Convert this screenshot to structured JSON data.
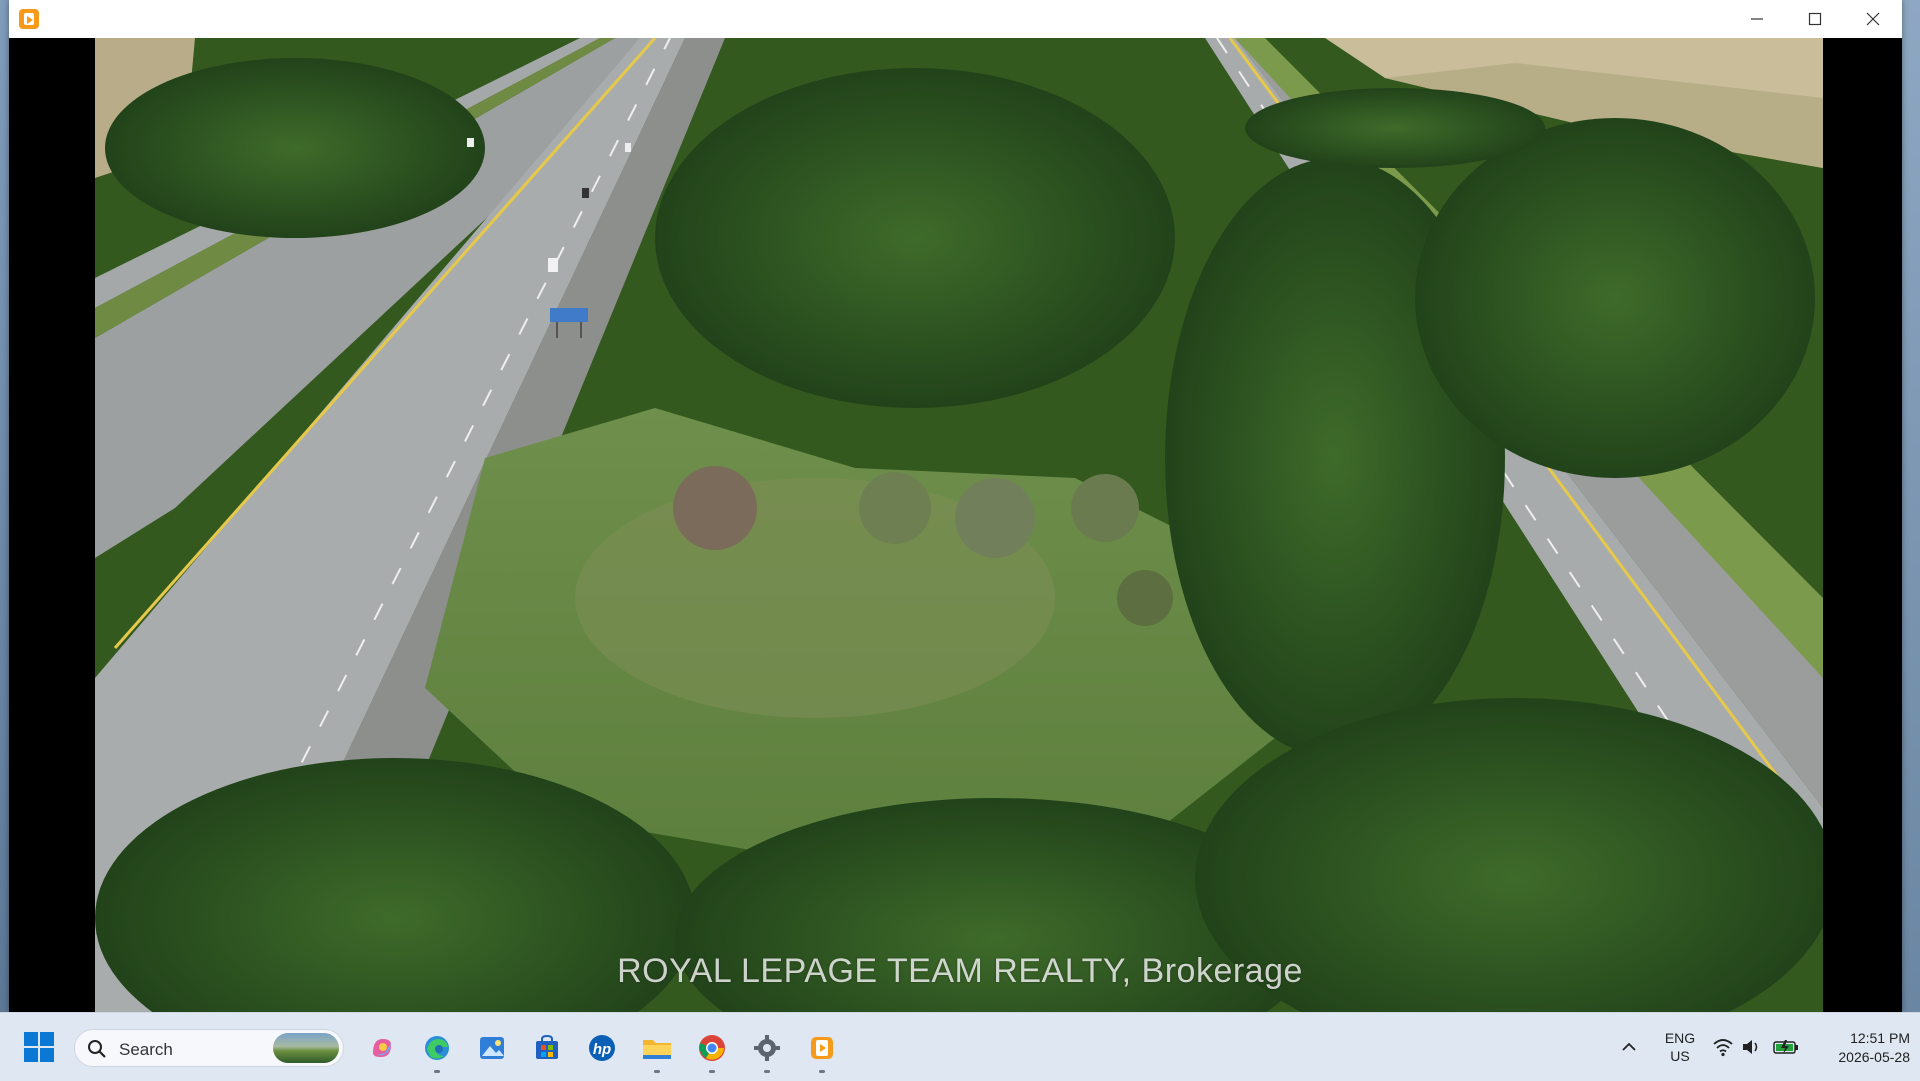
{
  "window": {
    "app_icon": "media-player-icon",
    "controls": [
      "minimize-icon",
      "maximize-icon",
      "close-icon"
    ]
  },
  "photo": {
    "description_icon": "aerial-photo",
    "watermark": "ROYAL LEPAGE TEAM REALTY, Brokerage"
  },
  "taskbar": {
    "start_icon": "windows-start-icon",
    "search": {
      "label": "Search",
      "icon": "search-icon"
    },
    "pinned": [
      {
        "name": "copilot-icon"
      },
      {
        "name": "edge-icon"
      },
      {
        "name": "photos-icon"
      },
      {
        "name": "store-icon"
      },
      {
        "name": "hp-icon"
      },
      {
        "name": "file-explorer-icon"
      },
      {
        "name": "chrome-icon"
      },
      {
        "name": "settings-icon"
      },
      {
        "name": "media-player-icon"
      }
    ],
    "tray": {
      "lang_line1": "ENG",
      "lang_line2": "US",
      "time": "12:51 PM",
      "date": "2026-05-28"
    },
    "colors": {
      "accent": "#0a78d4",
      "taskbar_bg": "#dfe8f2"
    }
  }
}
